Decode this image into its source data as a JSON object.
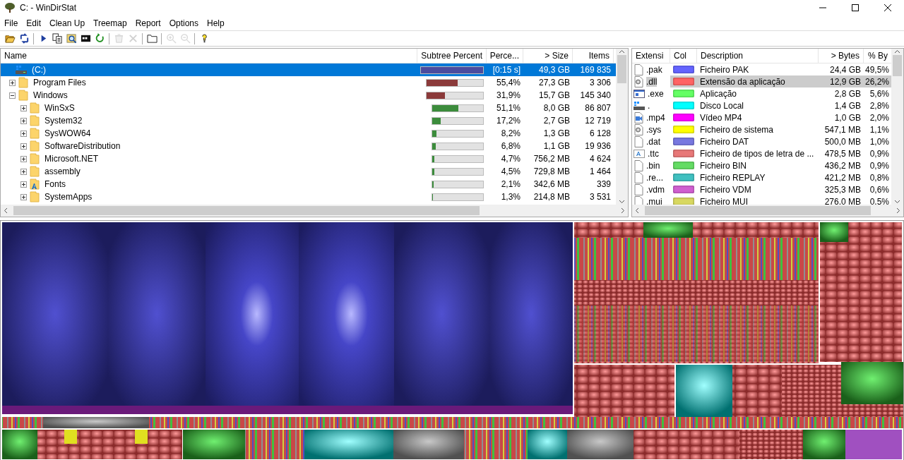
{
  "window": {
    "title": "C: - WinDirStat"
  },
  "menu": [
    {
      "label": "File"
    },
    {
      "label": "Edit"
    },
    {
      "label": "Clean Up"
    },
    {
      "label": "Treemap"
    },
    {
      "label": "Report"
    },
    {
      "label": "Options"
    },
    {
      "label": "Help"
    }
  ],
  "toolbar": [
    [
      {
        "disabled": false
      },
      {
        "disabled": false
      }
    ],
    [
      {
        "disabled": false
      },
      {
        "disabled": false
      },
      {
        "disabled": false
      },
      {
        "disabled": false
      },
      {
        "disabled": false
      }
    ],
    [
      {
        "disabled": true
      },
      {
        "disabled": true
      }
    ],
    [
      {
        "disabled": false
      }
    ],
    [
      {
        "disabled": true
      },
      {
        "disabled": true
      }
    ],
    [
      {
        "disabled": false
      }
    ]
  ],
  "tree": {
    "columns": [
      {
        "label": "Name"
      },
      {
        "label": "Subtree Percent"
      },
      {
        "label": "Perce..."
      },
      {
        "label": "> Size"
      },
      {
        "label": "Items"
      }
    ],
    "rows": [
      {
        "kind": "drive",
        "name": "(C:)",
        "level": 1,
        "percent": "[0:15 s]",
        "size": "49,3 GB",
        "items": "169 835",
        "selected": true,
        "children": [
          {
            "kind": "folder",
            "name": "Program Files",
            "level": 0.554,
            "percent": "55,4%",
            "size": "27,3 GB",
            "items": "3 306",
            "selected": false,
            "expanded": false
          },
          {
            "kind": "folder",
            "name": "Windows",
            "level": 0.319,
            "percent": "31,9%",
            "size": "15,7 GB",
            "items": "145 340",
            "selected": false,
            "expanded": true,
            "children": [
              {
                "kind": "folder",
                "name": "WinSxS",
                "level": 0.511,
                "percent": "51,1%",
                "size": "8,0 GB",
                "items": "86 807",
                "selected": false,
                "expanded": false
              },
              {
                "kind": "folder",
                "name": "System32",
                "level": 0.172,
                "percent": "17,2%",
                "size": "2,7 GB",
                "items": "12 719",
                "selected": false,
                "expanded": false
              },
              {
                "kind": "folder",
                "name": "SysWOW64",
                "level": 0.082,
                "percent": "8,2%",
                "size": "1,3 GB",
                "items": "6 128",
                "selected": false,
                "expanded": false
              },
              {
                "kind": "folder",
                "name": "SoftwareDistribution",
                "level": 0.068,
                "percent": "6,8%",
                "size": "1,1 GB",
                "items": "19 936",
                "selected": false,
                "expanded": false
              },
              {
                "kind": "folder",
                "name": "Microsoft.NET",
                "level": 0.047,
                "percent": "4,7%",
                "size": "756,2 MB",
                "items": "4 624",
                "selected": false,
                "expanded": false
              },
              {
                "kind": "folder",
                "name": "assembly",
                "level": 0.045,
                "percent": "4,5%",
                "size": "729,8 MB",
                "items": "1 464",
                "selected": false,
                "expanded": false
              },
              {
                "kind": "fonts",
                "name": "Fonts",
                "level": 0.021,
                "percent": "2,1%",
                "size": "342,6 MB",
                "items": "339",
                "selected": false,
                "expanded": false
              },
              {
                "kind": "folder",
                "name": "SystemApps",
                "level": 0.013,
                "percent": "1,3%",
                "size": "214,8 MB",
                "items": "3 531",
                "selected": false,
                "expanded": false
              }
            ]
          }
        ]
      }
    ]
  },
  "extensions": {
    "columns": [
      {
        "label": "Extensi"
      },
      {
        "label": "Col"
      },
      {
        "label": "Description"
      },
      {
        "label": "> Bytes"
      },
      {
        "label": "% By"
      }
    ],
    "rows": [
      {
        "kind": "file",
        "ext": ".pak",
        "color": "#6464ff",
        "description": "Ficheiro PAK",
        "bytes": "24,4 GB",
        "percent": "49,5%",
        "selected": false
      },
      {
        "kind": "system",
        "ext": ".dll",
        "color": "#ff6464",
        "description": "Extensão da aplicação",
        "bytes": "12,9 GB",
        "percent": "26,2%",
        "selected": true
      },
      {
        "kind": "app",
        "ext": ".exe",
        "color": "#64ff64",
        "description": "Aplicação",
        "bytes": "2,8 GB",
        "percent": "5,6%",
        "selected": false
      },
      {
        "kind": "drive",
        "ext": ".",
        "color": "#00ffff",
        "description": "Disco Local",
        "bytes": "1,4 GB",
        "percent": "2,8%",
        "selected": false
      },
      {
        "kind": "video",
        "ext": ".mp4",
        "color": "#ff00ff",
        "description": "Vídeo MP4",
        "bytes": "1,0 GB",
        "percent": "2,0%",
        "selected": false
      },
      {
        "kind": "system",
        "ext": ".sys",
        "color": "#ffff00",
        "description": "Ficheiro de sistema",
        "bytes": "547,1 MB",
        "percent": "1,1%",
        "selected": false
      },
      {
        "kind": "file",
        "ext": ".dat",
        "color": "#7878e0",
        "description": "Ficheiro DAT",
        "bytes": "500,0 MB",
        "percent": "1,0%",
        "selected": false
      },
      {
        "kind": "font",
        "ext": ".ttc",
        "color": "#e87878",
        "description": "Ficheiro de tipos de letra de ...",
        "bytes": "478,5 MB",
        "percent": "0,9%",
        "selected": false
      },
      {
        "kind": "file",
        "ext": ".bin",
        "color": "#64dc64",
        "description": "Ficheiro BIN",
        "bytes": "436,2 MB",
        "percent": "0,9%",
        "selected": false
      },
      {
        "kind": "file",
        "ext": ".re...",
        "color": "#40c0c0",
        "description": "Ficheiro REPLAY",
        "bytes": "421,2 MB",
        "percent": "0,8%",
        "selected": false
      },
      {
        "kind": "file",
        "ext": ".vdm",
        "color": "#d060d0",
        "description": "Ficheiro VDM",
        "bytes": "325,3 MB",
        "percent": "0,6%",
        "selected": false
      },
      {
        "kind": "file",
        "ext": ".mui",
        "color": "#d8d860",
        "description": "Ficheiro MUI",
        "bytes": "276,0 MB",
        "percent": "0,5%",
        "selected": false
      }
    ]
  }
}
